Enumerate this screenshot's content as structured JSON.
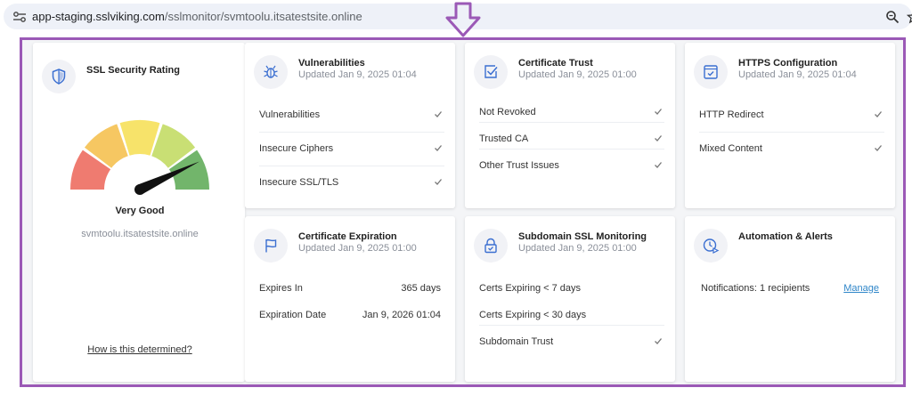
{
  "browser": {
    "url_host": "app-staging.sslviking.com",
    "url_path": "/sslmonitor/svmtoolu.itsatestsite.online",
    "icons": [
      "site-settings-icon",
      "zoom-icon",
      "bookmark-star-icon"
    ]
  },
  "annotation": {
    "arrow": "down-arrow-icon",
    "frame_color": "#9b59b6"
  },
  "rating": {
    "title": "SSL Security Rating",
    "label": "Very Good",
    "domain": "svmtoolu.itsatestsite.online",
    "link": "How is this determined?",
    "gauge_level": 0.86,
    "gauge_colors": [
      "#ef7b70",
      "#f6c762",
      "#f7e36a",
      "#c9df74",
      "#72b56b"
    ]
  },
  "vulnerabilities": {
    "title": "Vulnerabilities",
    "updated": "Updated Jan 9, 2025 01:04",
    "rows": [
      {
        "label": "Vulnerabilities",
        "status": "check"
      },
      {
        "label": "Insecure Ciphers",
        "status": "check"
      },
      {
        "label": "Insecure SSL/TLS",
        "status": "check"
      }
    ]
  },
  "certificate_trust": {
    "title": "Certificate Trust",
    "updated": "Updated Jan 9, 2025 01:00",
    "rows": [
      {
        "label": "Not Revoked",
        "status": "check"
      },
      {
        "label": "Trusted CA",
        "status": "check"
      },
      {
        "label": "Other Trust Issues",
        "status": "check"
      }
    ]
  },
  "https_config": {
    "title": "HTTPS Configuration",
    "updated": "Updated Jan 9, 2025 01:04",
    "rows": [
      {
        "label": "HTTP Redirect",
        "status": "check"
      },
      {
        "label": "Mixed Content",
        "status": "check"
      }
    ]
  },
  "cert_expiration": {
    "title": "Certificate Expiration",
    "updated": "Updated Jan 9, 2025 01:00",
    "rows": [
      {
        "label": "Expires In",
        "value": "365 days"
      },
      {
        "label": "Expiration Date",
        "value": "Jan 9, 2026 01:04"
      }
    ]
  },
  "subdomain": {
    "title": "Subdomain SSL Monitoring",
    "updated": "Updated Jan 9, 2025 01:00",
    "rows": [
      {
        "label": "Certs Expiring < 7 days"
      },
      {
        "label": "Certs Expiring < 30 days"
      },
      {
        "label": "Subdomain Trust",
        "status": "check"
      }
    ]
  },
  "automation": {
    "title": "Automation & Alerts",
    "notifications": "Notifications: 1 recipients",
    "manage": "Manage"
  }
}
